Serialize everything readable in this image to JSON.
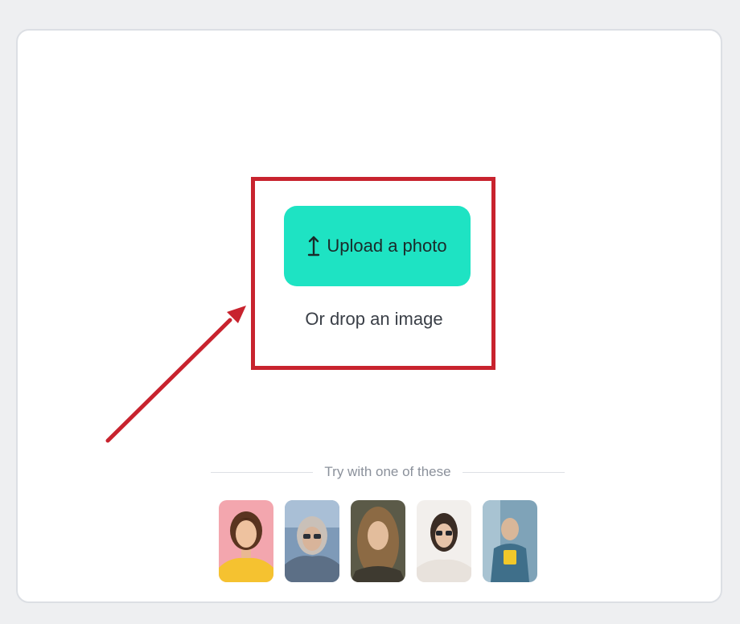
{
  "upload": {
    "button_label": "Upload a photo",
    "button_icon": "upload-icon",
    "drop_text": "Or drop an image"
  },
  "samples": {
    "divider_text": "Try with one of these",
    "items": [
      {
        "name": "sample-photo-1"
      },
      {
        "name": "sample-photo-2"
      },
      {
        "name": "sample-photo-3"
      },
      {
        "name": "sample-photo-4"
      },
      {
        "name": "sample-photo-5"
      }
    ]
  },
  "annotation": {
    "highlight_color": "#c8232e",
    "arrow_color": "#c8232e"
  },
  "colors": {
    "accent": "#1ee3c3",
    "card": "#ffffff",
    "background": "#eeeff1"
  }
}
